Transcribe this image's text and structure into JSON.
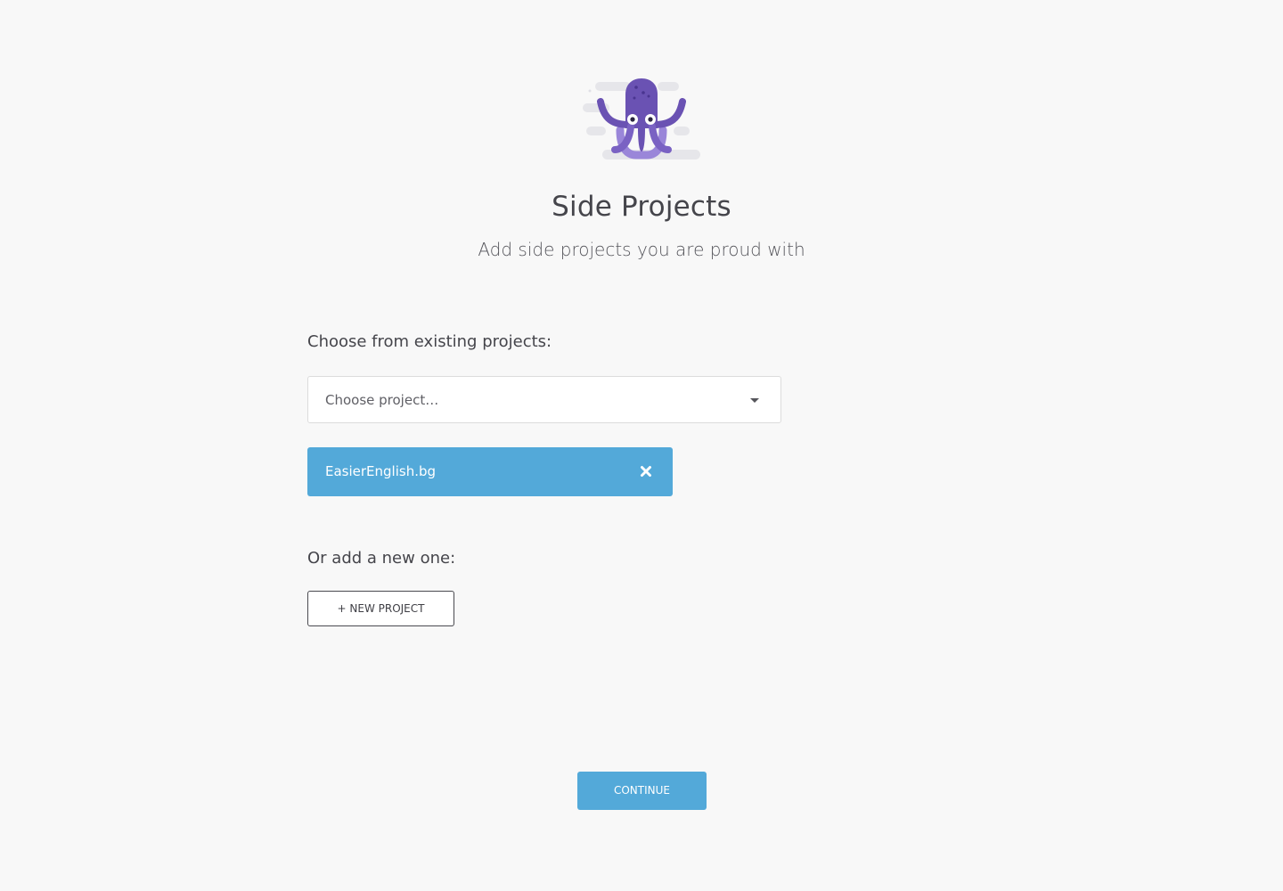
{
  "header": {
    "logo_icon": "octopus-mascot-icon",
    "title": "Side Projects",
    "subtitle": "Add side projects you are proud with"
  },
  "existing": {
    "label": "Choose from existing projects:",
    "select": {
      "placeholder": "Choose project…",
      "caret_icon": "caret-down-icon"
    },
    "selected_projects": [
      {
        "name": "EasierEnglish.bg",
        "remove_icon": "close-icon"
      }
    ]
  },
  "new_project": {
    "label": "Or add a new one:",
    "button_label": "+ New project"
  },
  "footer": {
    "continue_label": "Continue"
  },
  "colors": {
    "background": "#f8f8f8",
    "accent": "#53a9d9",
    "text": "#45454b",
    "mascot_purple": "#6a52b3",
    "mascot_light_purple": "#9a86d9"
  }
}
